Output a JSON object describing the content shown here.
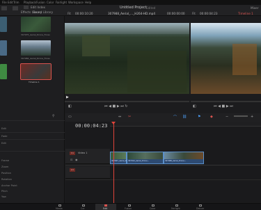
{
  "menubar": {
    "items": [
      "File",
      "Edit",
      "Trim",
      "Timeline",
      "Clip",
      "Mark",
      "View",
      "Playback",
      "Fusion",
      "Color",
      "Fairlight",
      "Workspace",
      "Help"
    ]
  },
  "toolbar": {
    "media_pool": "Media Pool",
    "effects_library": "Effects Library",
    "edit_index": "Edit Index",
    "sound_library": "Sound Library",
    "project_title": "Untitled Project",
    "project_status": "Edited",
    "source_fit": "Fit",
    "source_timecode": "00:00:10:20",
    "source_clip": "307988_Aerial_..._H264-HD.mp4",
    "program_timecode_left": "00:00:00:00",
    "program_fit": "Fit",
    "program_timecode": "00:00:04:23",
    "timeline_name": "Timeline 1",
    "mixer": "Mixer"
  },
  "media_pool": {
    "clips": [
      {
        "label": "307975_Aerial_Drone_Fores",
        "color": "#2f4a3a"
      },
      {
        "label": "307984_Aerial_Drone_Fores",
        "color": "#6d7b86"
      },
      {
        "label": "Timeline 1",
        "color": "#3a7a3f"
      }
    ]
  },
  "timeline": {
    "timecode": "00:00:04:23",
    "track_name": "Video 1",
    "track_id": "V1",
    "audio_id": "A1",
    "ruler_marks": [
      "00:00:00:00",
      "00:00:04:00",
      "00:00:08:00",
      "00:00:12:00"
    ],
    "clips": [
      "307907_Aerial_Drone_...",
      "307912_Aerial_Drone...",
      "307988_Aerial_Drone..."
    ]
  },
  "inspector": {
    "rows": [
      "Edit",
      "Fade",
      "Edit",
      "Frame",
      "Zoom",
      "Position",
      "Rotation",
      "Anchor Point",
      "Pitch",
      "Yaw",
      "Flip"
    ]
  },
  "pages": {
    "items": [
      "Media",
      "Cut",
      "Edit",
      "Fusion",
      "Color",
      "Fairlight",
      "Deliver"
    ],
    "active": "Edit"
  }
}
